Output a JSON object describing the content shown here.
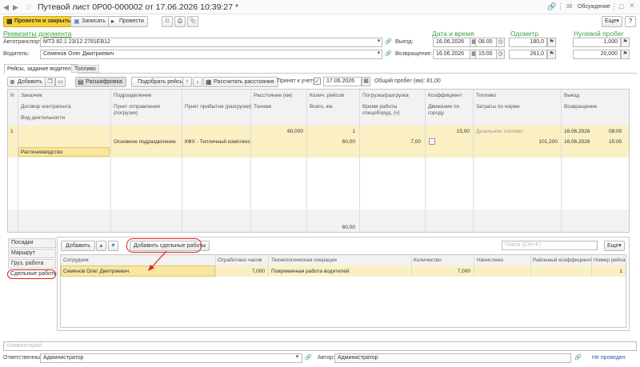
{
  "window": {
    "title": "Путевой лист 0Р00-000002 от 17.06.2026 10:39:27 *",
    "discussion": "Обсуждение",
    "more": "Еще"
  },
  "toolbar": {
    "post_close": "Провести и закрыть",
    "save": "Записать",
    "post": "Провести"
  },
  "sections": {
    "requisites": "Реквизиты документа",
    "datetime": "Дата и время",
    "odometer": "Одометр",
    "zero_run": "Нулевой пробег"
  },
  "form": {
    "vehicle_label": "Автотранспорт:",
    "vehicle_value": "МТЗ 82.1 23/12 2781ЕВ12",
    "driver_label": "Водитель:",
    "driver_value": "Семенов Олег Дмитриевич",
    "departure_label": "Выезд:",
    "departure_date": "16.06.2026",
    "departure_time": "08.00",
    "departure_odo": "180,0",
    "departure_zero": "1,000",
    "return_label": "Возвращение:",
    "return_date": "16.06.2026",
    "return_time": "15:00",
    "return_odo": "261,0",
    "return_zero": "20,000"
  },
  "tabs": {
    "trips": "Рейсы, задание водителю",
    "fuel": "Топливо"
  },
  "trips_toolbar": {
    "add": "Добавить",
    "breakdown": "Расшифровка",
    "select": "Подобрать рейсы",
    "calc": "Рассчитать расстояния",
    "accepted_label": "Принят к учету:",
    "accepted_date": "17.06.2026",
    "total_run": "Общий пробег (км): 81,00"
  },
  "grid": {
    "headers": {
      "n": "N",
      "customer": "Заказчик",
      "contract": "Договор контрагента",
      "activity": "Вид деятельности",
      "division": "Подразделение",
      "depart_point": "Пункт отправления (погрузки)",
      "arrive_point": "Пункт прибытия (разгрузки)",
      "distance": "Расстояние (км)",
      "tonnage": "Тоннаж",
      "trips_count": "Колич. рейсов",
      "total_km": "Всего, км.",
      "loading": "Погрузка/разгрузка",
      "work_time": "Время работы спецоборуд. (ч)",
      "coef": "Коэффициент",
      "city": "Движение по городу",
      "fuel": "Топливо",
      "fuel_norm": "Затраты по норме",
      "exit": "Выезд",
      "return": "Возвращение"
    },
    "row": {
      "n": "1",
      "activity": "Растениеводство",
      "division": "Основное подразделение",
      "arrive_point": "КФХ - Тепличный комплекс",
      "distance": "60,000",
      "trips_count": "1",
      "total_km": "60,00",
      "work_time": "7,00",
      "coef": "15,00",
      "fuel": "Дизельное топливо",
      "fuel_norm": "101,200",
      "exit_date": "16.06.2026",
      "exit_time": "08:00",
      "return_date": "16.06.2026",
      "return_time": "15:00"
    },
    "footer_total": "60,00"
  },
  "sidebar": {
    "items": [
      "Посадки",
      "Маршрут",
      "Груз, работа",
      "Сдельные работы"
    ]
  },
  "piece": {
    "add": "Добавить",
    "add_piece": "Добавить сдельные работы",
    "search": "Поиск (Ctrl+F)",
    "more": "Еще",
    "headers": {
      "employee": "Сотрудник",
      "hours": "Отработано часов",
      "operation": "Технологическая операция",
      "qty": "Количество",
      "accrued": "Начислено",
      "region": "Районный коэффициент",
      "trip_no": "Номер рейса"
    },
    "row": {
      "employee": "Семенов Олег Дмитриевич",
      "hours": "7,000",
      "operation": "Повременная работа водителей",
      "qty": "7,000",
      "trip_no": "1"
    }
  },
  "footer": {
    "comment_placeholder": "Комментарий",
    "responsible_label": "Ответственный:",
    "responsible": "Администратор",
    "author_label": "Автор:",
    "author": "Администратор",
    "status": "Не проведен"
  },
  "colors": {
    "primary": "#f7d330",
    "highlight": "#fbf0c3",
    "annotation": "#e02020",
    "section": "#3fa243"
  }
}
